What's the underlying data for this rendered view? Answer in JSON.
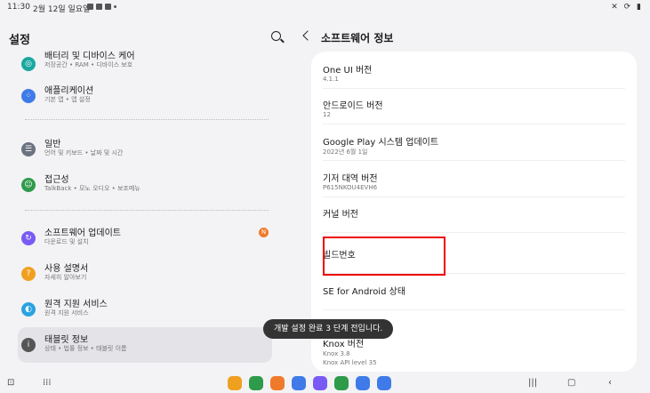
{
  "statusbar": {
    "time": "11:30",
    "date": "2월 12일 일요일",
    "right": "✕ ⟳ ▮"
  },
  "left": {
    "title": "설정",
    "items": [
      {
        "title": "배터리 및 디바이스 케어",
        "sub": "저장공간 • RAM • 디바이스 보호",
        "color": "#19a89f",
        "icon": "device-care-icon"
      },
      {
        "title": "애플리케이션",
        "sub": "기본 앱 • 앱 설정",
        "color": "#3e7be8",
        "icon": "apps-icon"
      },
      {
        "title": "일반",
        "sub": "언어 및 키보드 • 날짜 및 시간",
        "color": "#6b7280",
        "icon": "general-icon"
      },
      {
        "title": "접근성",
        "sub": "TalkBack • 모노 오디오 • 보조메뉴",
        "color": "#2e9b4b",
        "icon": "accessibility-icon"
      },
      {
        "title": "소프트웨어 업데이트",
        "sub": "다운로드 및 설치",
        "color": "#7a5af5",
        "icon": "software-update-icon",
        "badge": "N"
      },
      {
        "title": "사용 설명서",
        "sub": "자세히 알아보기",
        "color": "#f0a020",
        "icon": "manual-icon"
      },
      {
        "title": "원격 지원 서비스",
        "sub": "원격 지원 서비스",
        "color": "#2aa3e0",
        "icon": "remote-support-icon"
      },
      {
        "title": "태블릿 정보",
        "sub": "상태 • 법률 정보 • 태블릿 이름",
        "color": "#555",
        "icon": "tablet-info-icon"
      }
    ]
  },
  "right": {
    "title": "소프트웨어 정보",
    "rows": [
      {
        "title": "One UI 버전",
        "value": "4.1.1"
      },
      {
        "title": "안드로이드 버전",
        "value": "12"
      },
      {
        "title": "Google Play 시스템 업데이트",
        "value": "2022년 6월 1일"
      },
      {
        "title": "기저 대역 버전",
        "value": "P615NKOU4EVH6"
      },
      {
        "title": "커널 버전",
        "value": ""
      },
      {
        "title": "빌드번호",
        "value": ""
      },
      {
        "title": "SE for Android 상태",
        "value": ""
      },
      {
        "title": "Knox 버전",
        "value": "Knox 3.8\nKnox API level 35"
      }
    ]
  },
  "toast": "개발 설정 완료 3 단계 전입니다.",
  "dock_colors": [
    "#f0a020",
    "#2e9b4b",
    "#f07a2b",
    "#3e7be8",
    "#7a5af5",
    "#2e9b4b",
    "#3e7be8",
    "#3e7be8"
  ]
}
